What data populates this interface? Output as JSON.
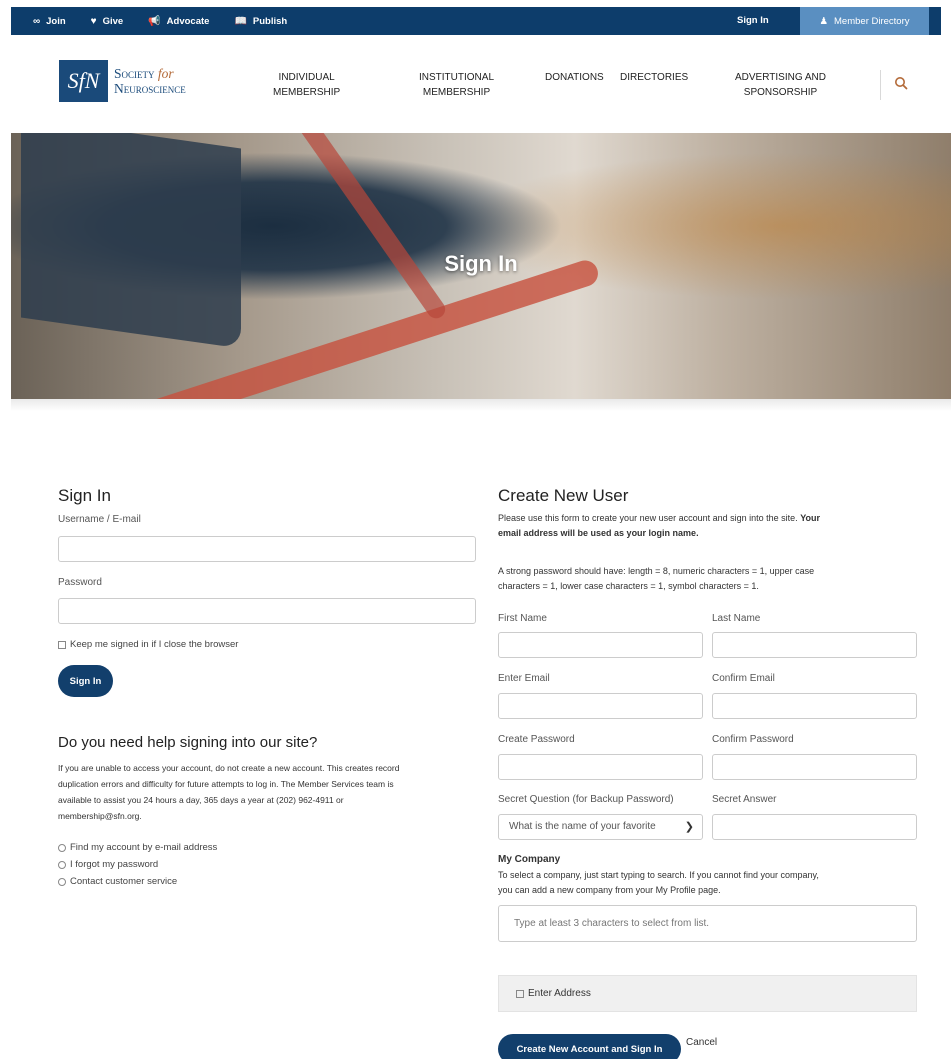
{
  "topbar": {
    "links": [
      {
        "icon": "join-icon",
        "glyph": "∞",
        "label": "Join"
      },
      {
        "icon": "heart-icon",
        "glyph": "♥",
        "label": "Give"
      },
      {
        "icon": "megaphone-icon",
        "glyph": "📢",
        "label": "Advocate"
      },
      {
        "icon": "book-icon",
        "glyph": "📖",
        "label": "Publish"
      }
    ],
    "sign_in": "Sign In",
    "member_directory": "Member Directory"
  },
  "logo": {
    "mark": "SfN",
    "line1a": "Society",
    "line1b": "for",
    "line2": "Neuroscience"
  },
  "nav": {
    "individual": [
      "INDIVIDUAL",
      "MEMBERSHIP"
    ],
    "institutional": [
      "INSTITUTIONAL",
      "MEMBERSHIP"
    ],
    "donations": "DONATIONS",
    "directories": "DIRECTORIES",
    "advertising": [
      "ADVERTISING AND",
      "SPONSORSHIP"
    ]
  },
  "hero": {
    "title": "Sign In"
  },
  "signin": {
    "heading": "Sign In",
    "username_label": "Username / E-mail",
    "password_label": "Password",
    "keep_signed": "Keep me signed in if I close the browser",
    "button": "Sign In"
  },
  "help": {
    "heading": "Do you need help signing into our site?",
    "lines": [
      "If you are unable to access your account, do not create a new account. This creates record",
      "duplication errors and difficulty for future attempts to log in. The Member Services team is",
      "available to assist you 24 hours a day, 365 days a year at (202) 962-4911 or",
      "membership@sfn.org."
    ],
    "options": [
      "Find my account by e-mail address",
      "I forgot my password",
      "Contact customer service"
    ]
  },
  "create": {
    "heading": "Create New User",
    "intro_line1": "Please use this form to create your new user account and sign into the site.",
    "intro_bold1": "Your",
    "intro_bold2": "email address will be used as your login name.",
    "pw_line1": "A strong password should have: length = 8, numeric characters = 1, upper case",
    "pw_line2": "characters = 1, lower case characters = 1, symbol characters = 1.",
    "first_name": "First Name",
    "last_name": "Last Name",
    "enter_email": "Enter Email",
    "confirm_email": "Confirm Email",
    "create_password": "Create Password",
    "confirm_password": "Confirm Password",
    "secret_question": "Secret Question (for Backup Password)",
    "secret_answer": "Secret Answer",
    "secret_question_value": "What is the name of your favorite",
    "company_heading": "My Company",
    "company_line1": "To select a company, just start typing to search. If you cannot find your company,",
    "company_line2": "you can add a new company from your My Profile page.",
    "company_placeholder": "Type at least 3 characters to select from list.",
    "enter_address": "Enter Address",
    "submit": "Create New Account and Sign In",
    "cancel": "Cancel"
  }
}
